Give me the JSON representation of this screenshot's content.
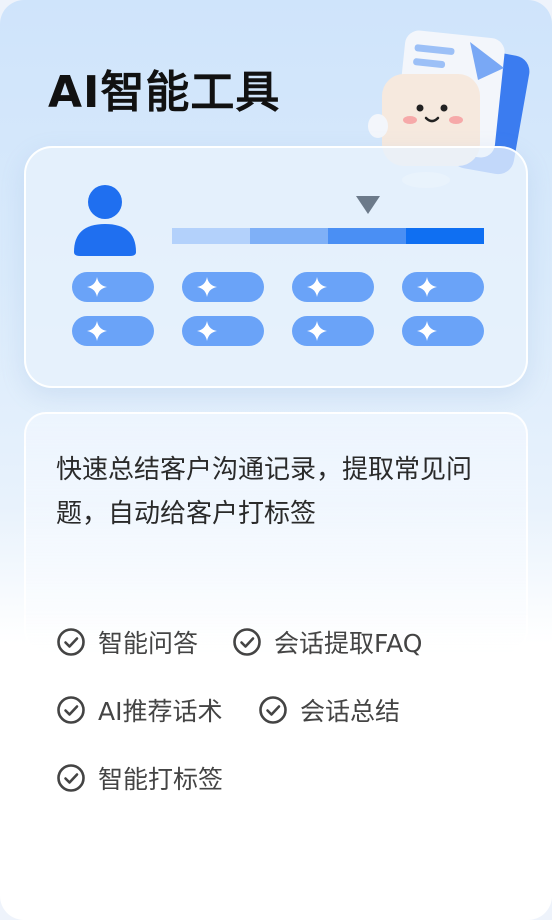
{
  "title": "AI智能工具",
  "description": "快速总结客户沟通记录，提取常见问题，自动给客户打标签",
  "progress_segments": [
    "#b3d1fb",
    "#7fb0f7",
    "#4a8ff4",
    "#0f6ff2"
  ],
  "features": [
    {
      "label": "智能问答"
    },
    {
      "label": "会话提取FAQ"
    },
    {
      "label": "AI推荐话术"
    },
    {
      "label": "会话总结"
    },
    {
      "label": "智能打标签"
    }
  ],
  "colors": {
    "accent": "#1f6ff0",
    "pill": "#6aa3f8",
    "check": "#444444"
  }
}
